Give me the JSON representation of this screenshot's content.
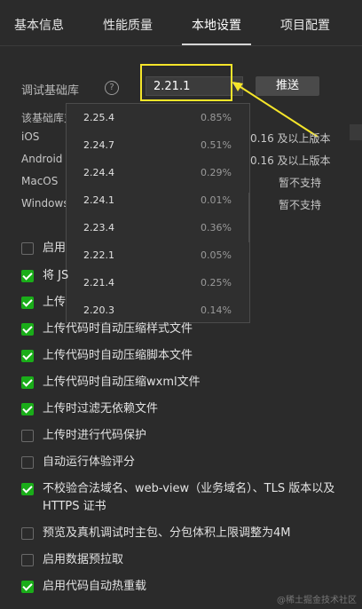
{
  "tabs": [
    "基本信息",
    "性能质量",
    "本地设置",
    "项目配置"
  ],
  "active_tab": "本地设置",
  "base_lib": {
    "label": "调试基础库",
    "help_icon": "?",
    "selected_version": "2.21.1",
    "push_label": "推送"
  },
  "support": {
    "title": "该基础库支",
    "rows": [
      {
        "platform": "iOS",
        "value": "0.16 及以上版本"
      },
      {
        "platform": "Android",
        "value": "0.16 及以上版本"
      },
      {
        "platform": "MacOS",
        "value": "暂不支持"
      },
      {
        "platform": "Windows",
        "value": "暂不支持"
      }
    ]
  },
  "dropdown": {
    "items": [
      {
        "version": "2.25.4",
        "pct": "0.85%"
      },
      {
        "version": "2.24.7",
        "pct": "0.51%"
      },
      {
        "version": "2.24.4",
        "pct": "0.29%"
      },
      {
        "version": "2.24.1",
        "pct": "0.01%"
      },
      {
        "version": "2.23.4",
        "pct": "0.36%"
      },
      {
        "version": "2.22.1",
        "pct": "0.05%"
      },
      {
        "version": "2.21.4",
        "pct": "0.25%"
      },
      {
        "version": "2.20.3",
        "pct": "0.14%"
      }
    ]
  },
  "checkboxes": [
    {
      "label": "启用",
      "checked": false
    },
    {
      "label": "将 JS",
      "checked": true
    },
    {
      "label": "上传",
      "checked": true
    },
    {
      "label": "上传代码时自动压缩样式文件",
      "checked": true
    },
    {
      "label": "上传代码时自动压缩脚本文件",
      "checked": true
    },
    {
      "label": "上传代码时自动压缩wxml文件",
      "checked": true
    },
    {
      "label": "上传时过滤无依赖文件",
      "checked": true
    },
    {
      "label": "上传时进行代码保护",
      "checked": false
    },
    {
      "label": "自动运行体验评分",
      "checked": false
    },
    {
      "label": "不校验合法域名、web-view（业务域名）、TLS 版本以及 HTTPS 证书",
      "checked": true
    },
    {
      "label": "预览及真机调试时主包、分包体积上限调整为4M",
      "checked": false
    },
    {
      "label": "启用数据预拉取",
      "checked": false
    },
    {
      "label": "启用代码自动热重载",
      "checked": true
    }
  ],
  "watermark": "@稀土掘金技术社区",
  "colors": {
    "background": "#2b2b2b",
    "checkbox_on": "#1aad19",
    "highlight": "#f5e52a"
  }
}
